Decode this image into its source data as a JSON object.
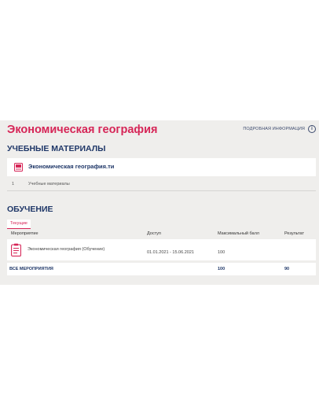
{
  "course": {
    "title": "Экономическая география",
    "more_info": "ПОДРОБНАЯ ИНФОРМАЦИЯ"
  },
  "materials": {
    "heading": "УЧЕБНЫЕ МАТЕРИАЛЫ",
    "file_name": "Экономическая география.ти",
    "row": {
      "number": "1",
      "label": "Учебные материалы"
    }
  },
  "training": {
    "heading": "ОБУЧЕНИЕ",
    "tab_current": "Текущие",
    "columns": {
      "event": "Мероприятие",
      "access": "Доступ",
      "max_score": "Максимальный балл",
      "result": "Результат"
    },
    "rows": [
      {
        "event": "Экономическая география (Обучение)",
        "access": "01.01.2021 - 15.06.2021",
        "max_score": "100",
        "result": ""
      }
    ],
    "total": {
      "label": "ВСЕ МЕРОПРИЯТИЯ",
      "max_score": "100",
      "result": "90"
    }
  },
  "colors": {
    "accent": "#d62557",
    "heading": "#1f3768",
    "panel_bg": "#efeeec"
  },
  "icons": {
    "info": "info-icon",
    "material": "book-icon",
    "event": "clipboard-icon"
  }
}
